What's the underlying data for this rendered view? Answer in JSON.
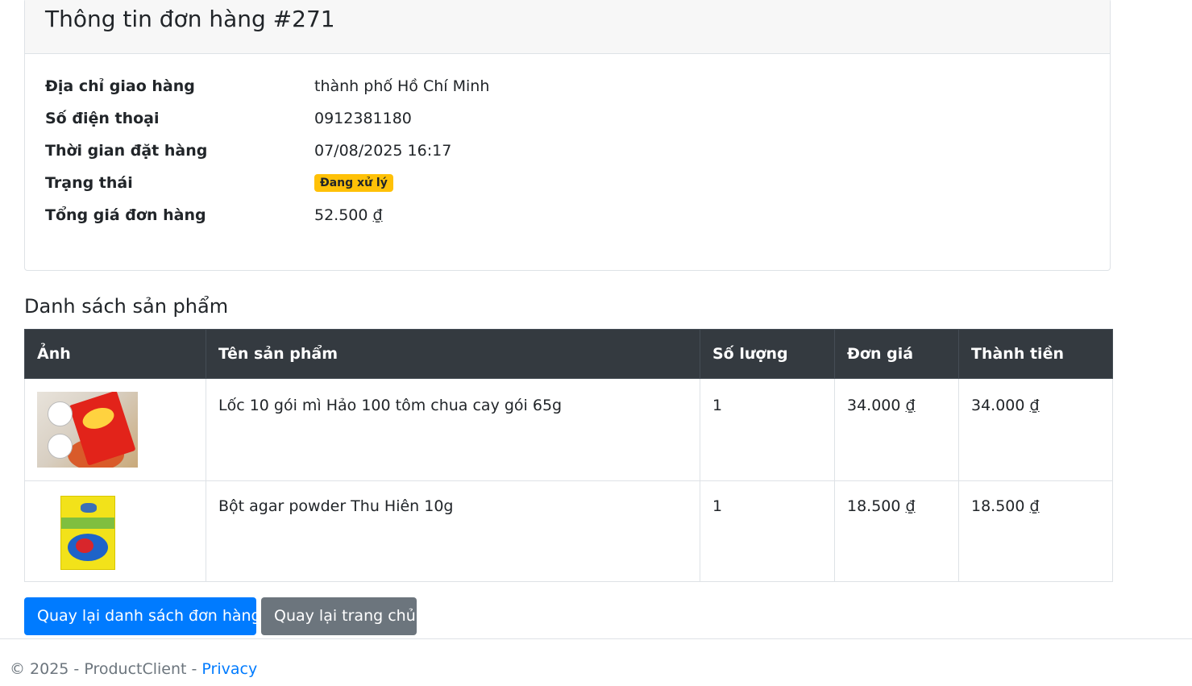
{
  "order": {
    "title": "Thông tin đơn hàng #271",
    "fields": [
      {
        "label": "Địa chỉ giao hàng",
        "value": "thành phố Hồ Chí Minh"
      },
      {
        "label": "Số điện thoại",
        "value": "0912381180"
      },
      {
        "label": "Thời gian đặt hàng",
        "value": "07/08/2025 16:17"
      },
      {
        "label": "Trạng thái",
        "value": "Đang xử lý"
      },
      {
        "label": "Tổng giá đơn hàng",
        "value": "52.500",
        "currency": "₫"
      }
    ],
    "status_color": "#ffc107"
  },
  "products": {
    "title": "Danh sách sản phẩm",
    "columns": [
      "Ảnh",
      "Tên sản phẩm",
      "Số lượng",
      "Đơn giá",
      "Thành tiền"
    ],
    "rows": [
      {
        "image": "hao-hao-noodle-pack-image",
        "name": "Lốc 10 gói mì Hảo 100 tôm chua cay gói 65g",
        "quantity": "1",
        "unit_price": "34.000",
        "total": "34.000",
        "currency": "₫"
      },
      {
        "image": "agar-powder-pack-image",
        "name": "Bột agar powder Thu Hiên 10g",
        "quantity": "1",
        "unit_price": "18.500",
        "total": "18.500",
        "currency": "₫"
      }
    ]
  },
  "actions": {
    "back_to_orders": "Quay lại danh sách đơn hàng",
    "back_to_home": "Quay lại trang chủ",
    "primary_color": "#007bff",
    "secondary_color": "#6c757d"
  },
  "footer": {
    "text": "© 2025 - ProductClient - ",
    "privacy_link": "Privacy"
  },
  "theme": {
    "table_header_bg": "#343a40",
    "card_header_bg": "#f7f7f7"
  }
}
